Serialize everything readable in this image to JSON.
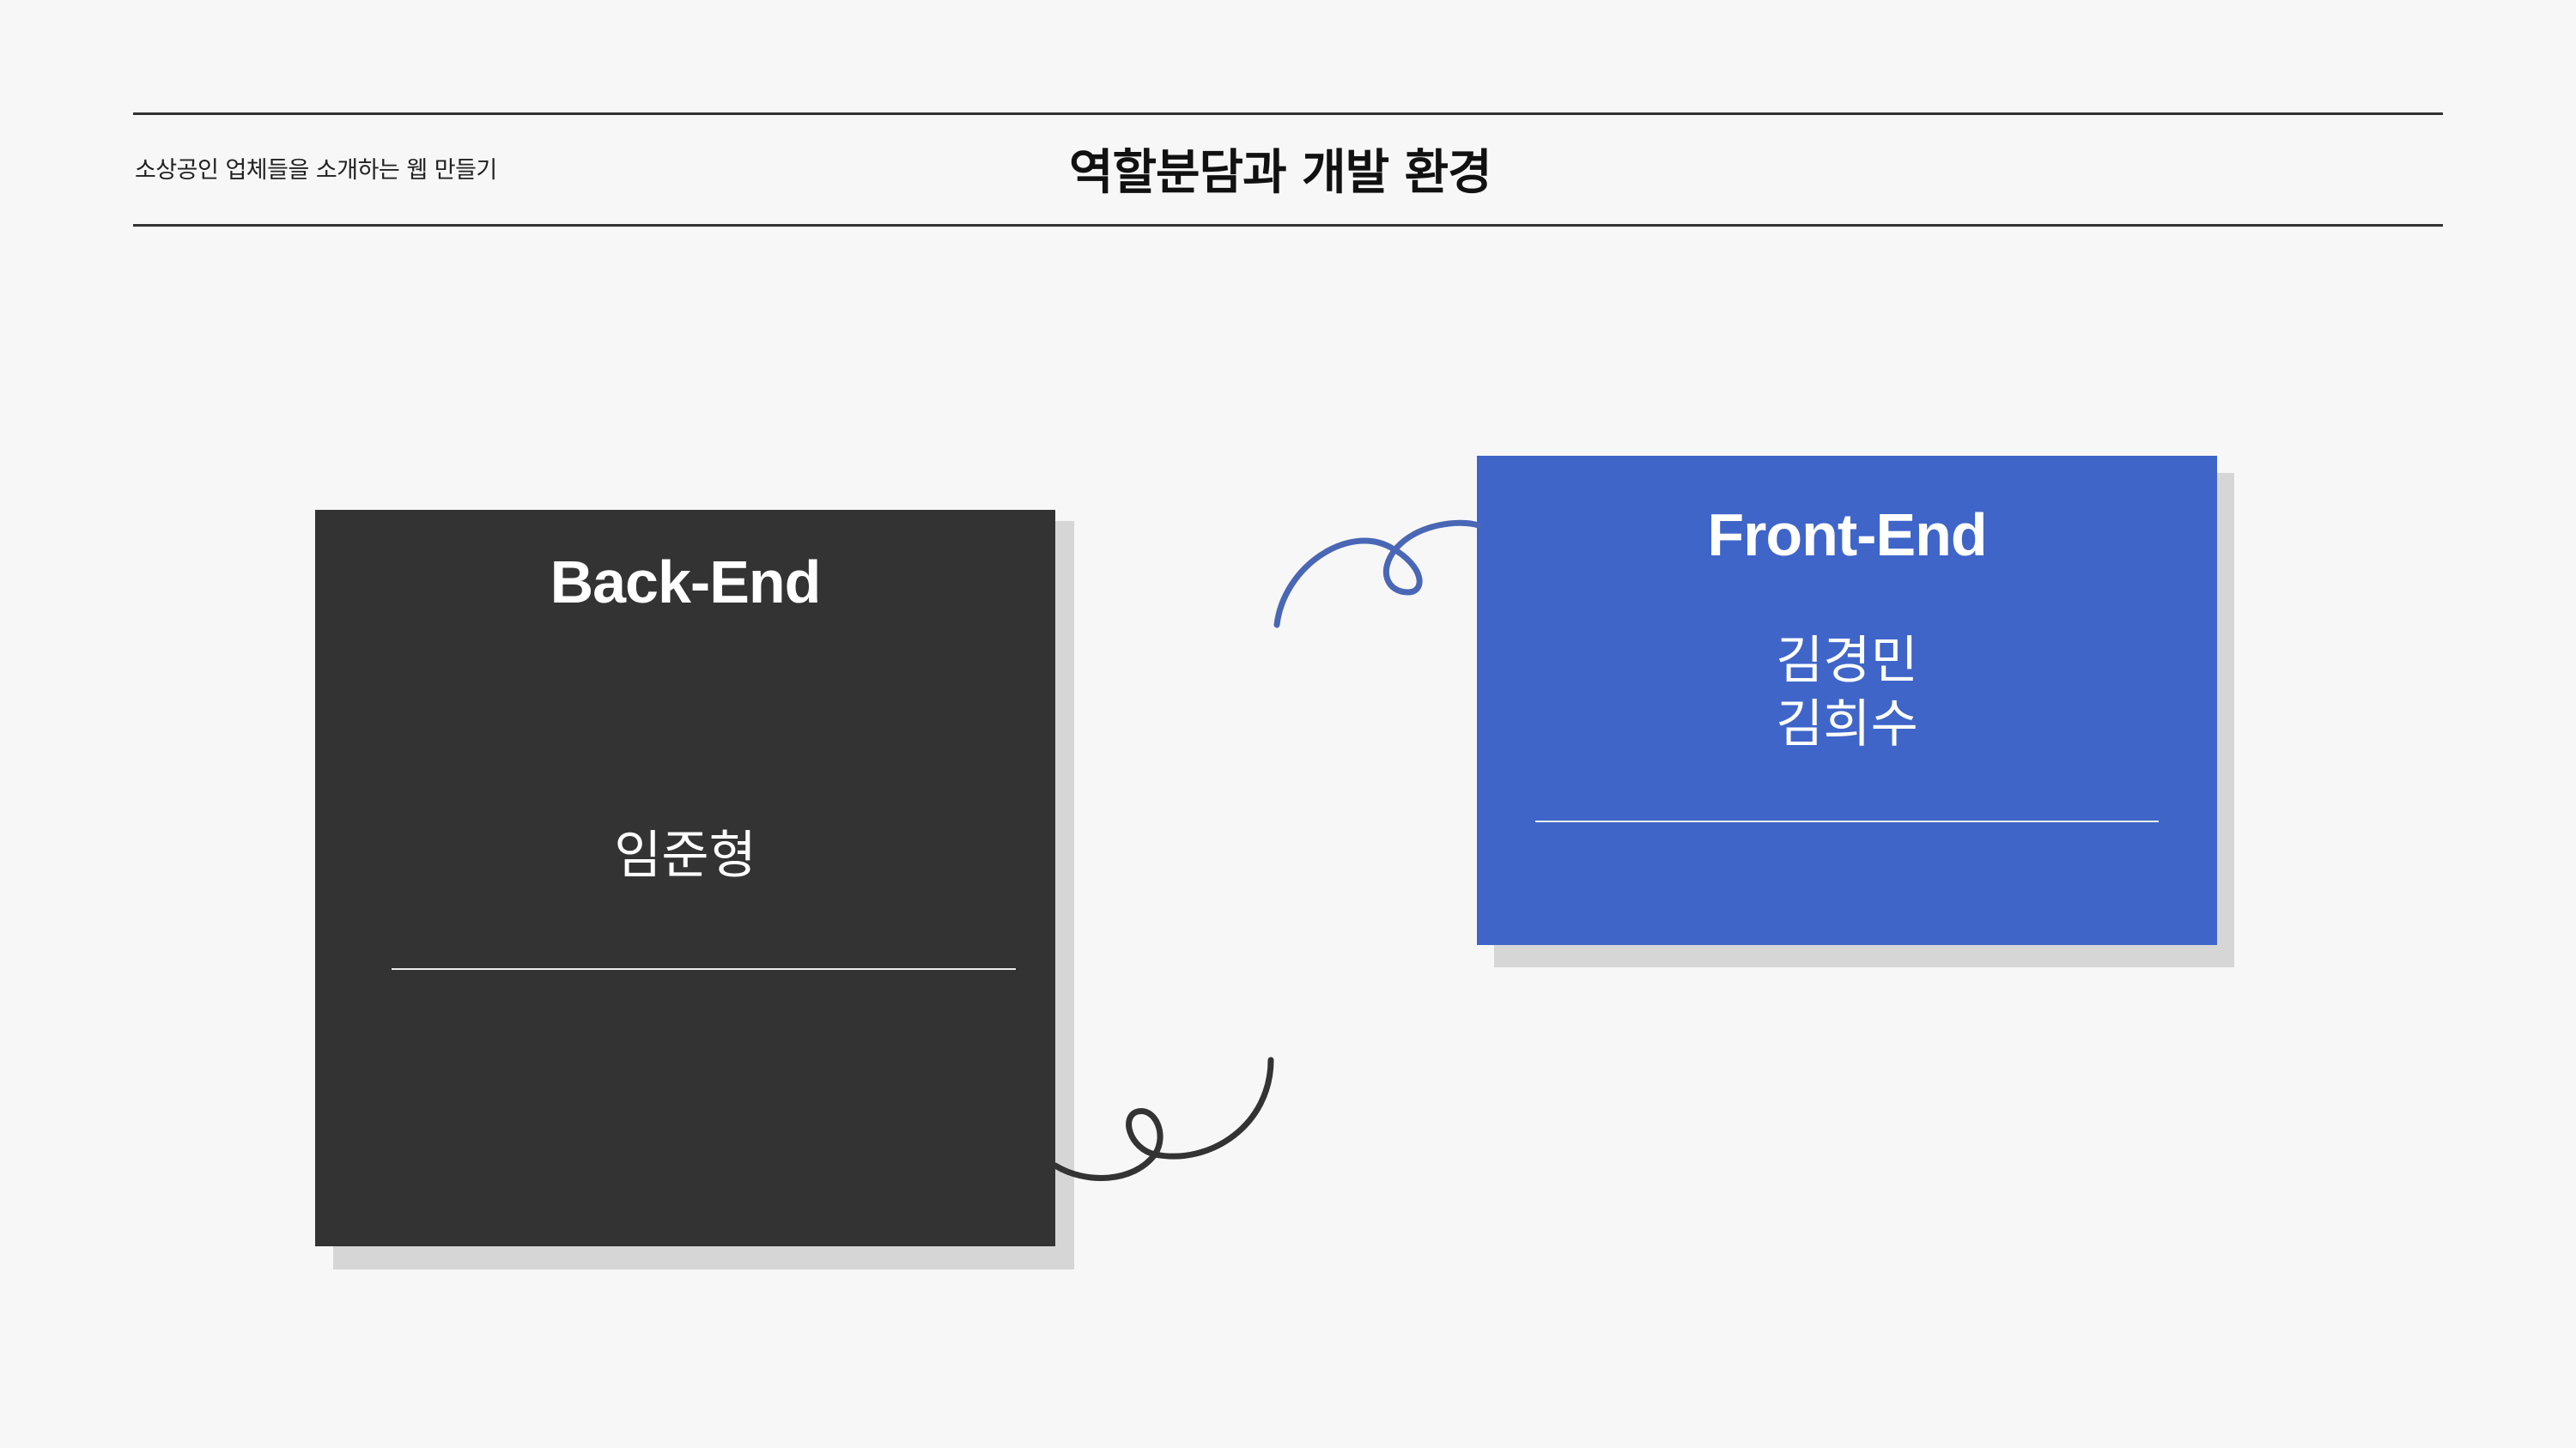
{
  "header": {
    "subtitle": "소상공인 업체들을 소개하는 웹 만들기",
    "title": "역할분담과 개발 환경"
  },
  "cards": {
    "backend": {
      "title": "Back-End",
      "names": "임준형",
      "color": "#333333"
    },
    "frontend": {
      "title": "Front-End",
      "name_1": "김경민",
      "name_2": "김희수",
      "color": "#3f65c8"
    }
  },
  "colors": {
    "background": "#f7f7f7",
    "shadow": "#d6d6d6",
    "squiggle_blue": "#4a67b5",
    "squiggle_dark": "#333333"
  }
}
